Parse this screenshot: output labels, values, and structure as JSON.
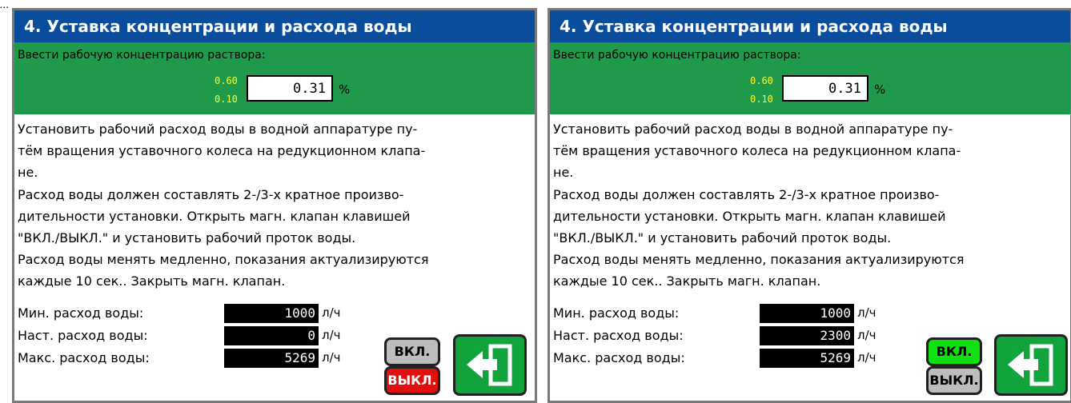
{
  "caption": "...",
  "panels": [
    {
      "title": "4. Уставка концентрации и расхода воды",
      "concentration": {
        "label": "Ввести рабочую концентрацию раствора:",
        "max": "0.60",
        "min": "0.10",
        "value": "0.31",
        "unit": "%"
      },
      "description": [
        "Установить рабочий расход воды в водной аппаратуре пу-",
        "тём вращения уставочного колеса на редукционном клапа-",
        "не.",
        "Расход воды должен составлять 2-/3-х кратное произво-",
        "дительности установки. Открыть магн. клапан клавишей",
        "\"ВКЛ./ВЫКЛ.\" и установить рабочий проток воды.",
        "Расход воды менять медленно, показания актуализируются",
        "каждые 10 сек.. Закрыть магн. клапан."
      ],
      "flows": [
        {
          "label": "Мин. расход воды:",
          "value": "1000",
          "unit": "л/ч"
        },
        {
          "label": "Наст. расход воды:",
          "value": "0",
          "unit": "л/ч"
        },
        {
          "label": "Макс. расход воды:",
          "value": "5269",
          "unit": "л/ч"
        }
      ],
      "on_label": "ВКЛ.",
      "off_label": "ВЫКЛ.",
      "on_color": "#bdbdbd",
      "off_color": "#e01010",
      "exit_icon": "exit-arrow-icon"
    },
    {
      "title": "4. Уставка концентрации и расхода воды",
      "concentration": {
        "label": "Ввести рабочую концентрацию раствора:",
        "max": "0.60",
        "min": "0.10",
        "value": "0.31",
        "unit": "%"
      },
      "description": [
        "Установить рабочий расход воды в водной аппаратуре пу-",
        "тём вращения уставочного колеса на редукционном клапа-",
        "не.",
        "Расход воды должен составлять 2-/3-х кратное произво-",
        "дительности установки. Открыть магн. клапан клавишей",
        "\"ВКЛ./ВЫКЛ.\" и установить рабочий проток воды.",
        "Расход воды менять медленно, показания актуализируются",
        "каждые 10 сек.. Закрыть магн. клапан."
      ],
      "flows": [
        {
          "label": "Мин. расход воды:",
          "value": "1000",
          "unit": "л/ч"
        },
        {
          "label": "Наст. расход воды:",
          "value": "2300",
          "unit": "л/ч"
        },
        {
          "label": "Макс. расход воды:",
          "value": "5269",
          "unit": "л/ч"
        }
      ],
      "on_label": "ВКЛ.",
      "off_label": "ВЫКЛ.",
      "on_color": "#10e010",
      "off_color": "#bdbdbd",
      "exit_icon": "exit-arrow-icon"
    }
  ]
}
